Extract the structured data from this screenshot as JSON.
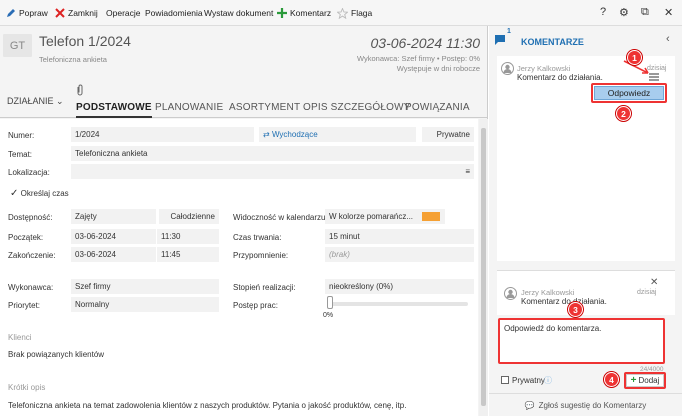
{
  "toolbar": {
    "popraw": "Popraw",
    "zamknij": "Zamknij",
    "operacje": "Operacje",
    "powiadomienia": "Powiadomienia",
    "wystaw": "Wystaw dokument",
    "komentarz": "Komentarz",
    "flaga": "Flaga",
    "help": "?",
    "settings": "⚙",
    "popout": "⧉",
    "close": "✕"
  },
  "header": {
    "avatar": "GT",
    "title": "Telefon 1/2024",
    "subtitle": "Telefoniczna ankieta",
    "date": "03-06-2024 11:30",
    "meta1": "Wykonawca: Szef firmy • Postęp: 0%",
    "meta2": "Występuje w dni robocze"
  },
  "tabs": {
    "dzialanie": "DZIAŁANIE",
    "items": [
      "PODSTAWOWE",
      "PLANOWANIE",
      "ASORTYMENT",
      "OPIS SZCZEGÓŁOWY",
      "POWIĄZANIA"
    ]
  },
  "form": {
    "numer_label": "Numer:",
    "numer_value": "1/2024",
    "direction": "Wychodzące",
    "prywatne": "Prywatne",
    "temat_label": "Temat:",
    "temat_value": "Telefoniczna ankieta",
    "lokalizacja_label": "Lokalizacja:",
    "lokalizacja_icon": "≡",
    "okreslaj": "Określaj czas",
    "dostepnosc_label": "Dostępność:",
    "dostepnosc_value": "Zajęty",
    "calodzienne": "Całodzienne",
    "widocznosc_label": "Widoczność w kalendarzu:",
    "widocznosc_value": "W kolorze pomarańcz...",
    "poczatek_label": "Początek:",
    "poczatek_date": "03-06-2024",
    "poczatek_time": "11:30",
    "czas_label": "Czas trwania:",
    "czas_value": "15 minut",
    "zakonczenie_label": "Zakończenie:",
    "zakonczenie_date": "03-06-2024",
    "zakonczenie_time": "11:45",
    "przypomnienie_label": "Przypomnienie:",
    "przypomnienie_value": "(brak)",
    "wykonawca_label": "Wykonawca:",
    "wykonawca_value": "Szef firmy",
    "stopien_label": "Stopień realizacji:",
    "stopien_value": "nieokreślony  (0%)",
    "priorytet_label": "Priorytet:",
    "priorytet_value": "Normalny",
    "postep_label": "Postęp prac:",
    "postep_value": "0%",
    "postep_fraction": 0,
    "klienci_head": "Klienci",
    "klienci_text": "Brak powiązanych klientów",
    "opis_head": "Krótki opis",
    "opis_text": "Telefoniczna ankieta na temat zadowolenia klientów z naszych produktów. Pytania o jakość produktów, cenę, itp."
  },
  "panel": {
    "title": "KOMENTARZE",
    "badge": "1",
    "comment1": {
      "author": "Jerzy Kalkowski",
      "text": "Komentarz do działania.",
      "time": "dzisiaj"
    },
    "reply_button": "Odpowiedz",
    "comment2": {
      "author": "Jerzy Kalkowski",
      "text": "Komentarz do działania.",
      "time": "dzisiaj"
    },
    "reply_text": "Odpowiedź do komentarza.",
    "counter": "24/4000",
    "prywatny": "Prywatny",
    "add_button": "Dodaj",
    "footer": "Zgłoś sugestię do Komentarzy"
  },
  "callouts": [
    "1",
    "2",
    "3",
    "4"
  ],
  "colors": {
    "accent": "#1f6fb2",
    "green": "#2a9a3a",
    "red": "#e33333",
    "orange": "#f5a033"
  }
}
